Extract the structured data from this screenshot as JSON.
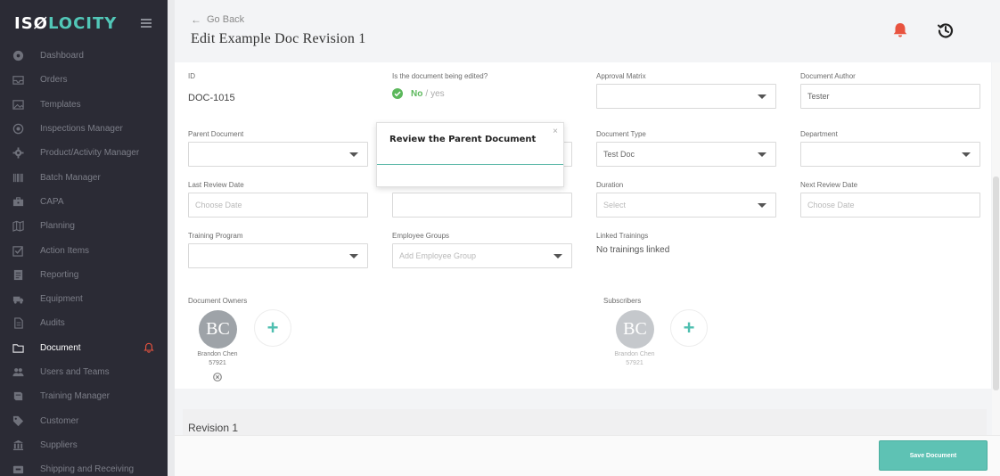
{
  "app": {
    "logo_a": "ISØ",
    "logo_b": "LOCITY"
  },
  "sidebar": {
    "items": [
      {
        "label": "Dashboard",
        "icon": "dashboard-icon"
      },
      {
        "label": "Orders",
        "icon": "inbox-icon"
      },
      {
        "label": "Templates",
        "icon": "image-icon"
      },
      {
        "label": "Inspections Manager",
        "icon": "target-icon"
      },
      {
        "label": "Product/Activity Manager",
        "icon": "gear-icon"
      },
      {
        "label": "Batch Manager",
        "icon": "barcode-icon"
      },
      {
        "label": "CAPA",
        "icon": "briefcase-icon"
      },
      {
        "label": "Planning",
        "icon": "map-icon"
      },
      {
        "label": "Action Items",
        "icon": "checkbox-icon"
      },
      {
        "label": "Reporting",
        "icon": "report-icon"
      },
      {
        "label": "Equipment",
        "icon": "truck-icon"
      },
      {
        "label": "Audits",
        "icon": "clipboard-icon"
      },
      {
        "label": "Document",
        "icon": "folder-icon",
        "active": true
      },
      {
        "label": "Users and Teams",
        "icon": "users-icon"
      },
      {
        "label": "Training Manager",
        "icon": "book-icon"
      },
      {
        "label": "Customer",
        "icon": "tag-icon"
      },
      {
        "label": "Suppliers",
        "icon": "building-icon"
      },
      {
        "label": "Shipping and Receiving",
        "icon": "box-icon"
      }
    ]
  },
  "header": {
    "go_back": "Go Back",
    "title": "Edit Example Doc Revision 1"
  },
  "form": {
    "id_label": "ID",
    "id_value": "DOC-1015",
    "edited_label": "Is the document being edited?",
    "edited_no": "No",
    "edited_sep": "/",
    "edited_yes": "yes",
    "approval_label": "Approval Matrix",
    "author_label": "Document Author",
    "author_value": "Tester",
    "parent_label": "Parent Document",
    "type_label": "Document Type",
    "type_value": "Test Doc",
    "department_label": "Department",
    "last_review_label": "Last Review Date",
    "last_review_ph": "Choose Date",
    "duration_label": "Duration",
    "duration_ph": "Select",
    "next_review_label": "Next Review Date",
    "next_review_ph": "Choose Date",
    "training_label": "Training Program",
    "groups_label": "Employee Groups",
    "groups_ph": "Add Employee Group",
    "linked_label": "Linked Trainings",
    "linked_value": "No trainings linked",
    "owners_label": "Document Owners",
    "subscribers_label": "Subscribers",
    "owner_initials": "BC",
    "owner_name": "Brandon Chen",
    "owner_id": "57921",
    "subscriber_initials": "BC",
    "subscriber_name": "Brandon Chen",
    "subscriber_id": "57921",
    "add_symbol": "+"
  },
  "popup": {
    "title": "Review the Parent Document",
    "close": "×"
  },
  "revision": {
    "title": "Revision 1"
  },
  "footer": {
    "save_label": "Save Document"
  },
  "colors": {
    "sidebar_bg": "#2b2b35",
    "accent": "#5ec2b4",
    "alert_red": "#e8533f",
    "success_green": "#5cb85c"
  }
}
